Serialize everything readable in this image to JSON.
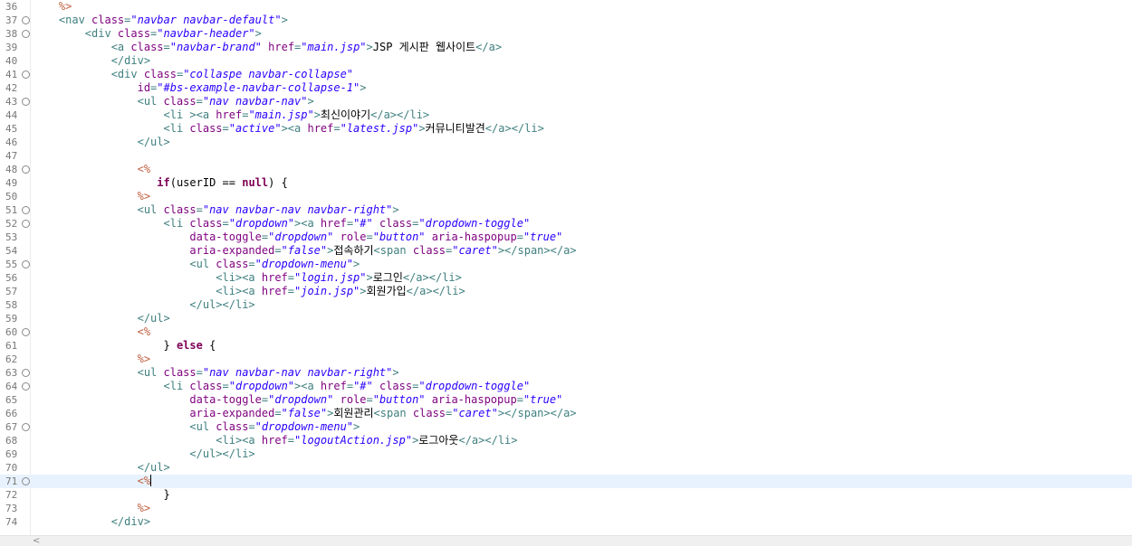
{
  "editor": {
    "current_line": "71",
    "lines": [
      {
        "n": "36",
        "fold": false,
        "indent": "    ",
        "tokens": [
          {
            "t": "%>",
            "c": "jsp"
          }
        ]
      },
      {
        "n": "37",
        "fold": true,
        "indent": "    ",
        "tokens": [
          {
            "t": "<nav ",
            "c": "tag"
          },
          {
            "t": "class",
            "c": "attr"
          },
          {
            "t": "=",
            "c": "tag"
          },
          {
            "t": "\"navbar navbar-default\"",
            "c": "val"
          },
          {
            "t": ">",
            "c": "tag"
          }
        ]
      },
      {
        "n": "38",
        "fold": true,
        "indent": "        ",
        "tokens": [
          {
            "t": "<div ",
            "c": "tag"
          },
          {
            "t": "class",
            "c": "attr"
          },
          {
            "t": "=",
            "c": "tag"
          },
          {
            "t": "\"navbar-header\"",
            "c": "val"
          },
          {
            "t": ">",
            "c": "tag"
          }
        ]
      },
      {
        "n": "39",
        "fold": false,
        "indent": "            ",
        "tokens": [
          {
            "t": "<a ",
            "c": "tag"
          },
          {
            "t": "class",
            "c": "attr"
          },
          {
            "t": "=",
            "c": "tag"
          },
          {
            "t": "\"navbar-brand\"",
            "c": "val"
          },
          {
            "t": " ",
            "c": "tag"
          },
          {
            "t": "href",
            "c": "attr"
          },
          {
            "t": "=",
            "c": "tag"
          },
          {
            "t": "\"main.jsp\"",
            "c": "val"
          },
          {
            "t": ">",
            "c": "tag"
          },
          {
            "t": "JSP 게시판 웹사이트",
            "c": "text"
          },
          {
            "t": "</a>",
            "c": "tag"
          }
        ]
      },
      {
        "n": "40",
        "fold": false,
        "indent": "            ",
        "tokens": [
          {
            "t": "</div>",
            "c": "tag"
          }
        ]
      },
      {
        "n": "41",
        "fold": true,
        "indent": "            ",
        "tokens": [
          {
            "t": "<div ",
            "c": "tag"
          },
          {
            "t": "class",
            "c": "attr"
          },
          {
            "t": "=",
            "c": "tag"
          },
          {
            "t": "\"collaspe navbar-collapse\"",
            "c": "val"
          }
        ]
      },
      {
        "n": "42",
        "fold": false,
        "indent": "                ",
        "tokens": [
          {
            "t": "id",
            "c": "attr"
          },
          {
            "t": "=",
            "c": "tag"
          },
          {
            "t": "\"#bs-example-navbar-collapse-1\"",
            "c": "val"
          },
          {
            "t": ">",
            "c": "tag"
          }
        ]
      },
      {
        "n": "43",
        "fold": true,
        "indent": "                ",
        "tokens": [
          {
            "t": "<ul ",
            "c": "tag"
          },
          {
            "t": "class",
            "c": "attr"
          },
          {
            "t": "=",
            "c": "tag"
          },
          {
            "t": "\"nav navbar-nav\"",
            "c": "val"
          },
          {
            "t": ">",
            "c": "tag"
          }
        ]
      },
      {
        "n": "44",
        "fold": false,
        "indent": "                    ",
        "tokens": [
          {
            "t": "<li ><a ",
            "c": "tag"
          },
          {
            "t": "href",
            "c": "attr"
          },
          {
            "t": "=",
            "c": "tag"
          },
          {
            "t": "\"main.jsp\"",
            "c": "val"
          },
          {
            "t": ">",
            "c": "tag"
          },
          {
            "t": "최신이야기",
            "c": "text"
          },
          {
            "t": "</a></li>",
            "c": "tag"
          }
        ]
      },
      {
        "n": "45",
        "fold": false,
        "indent": "                    ",
        "tokens": [
          {
            "t": "<li ",
            "c": "tag"
          },
          {
            "t": "class",
            "c": "attr"
          },
          {
            "t": "=",
            "c": "tag"
          },
          {
            "t": "\"active\"",
            "c": "val"
          },
          {
            "t": "><a ",
            "c": "tag"
          },
          {
            "t": "href",
            "c": "attr"
          },
          {
            "t": "=",
            "c": "tag"
          },
          {
            "t": "\"latest.jsp\"",
            "c": "val"
          },
          {
            "t": ">",
            "c": "tag"
          },
          {
            "t": "커뮤니티발견",
            "c": "text"
          },
          {
            "t": "</a></li>",
            "c": "tag"
          }
        ]
      },
      {
        "n": "46",
        "fold": false,
        "indent": "                ",
        "tokens": [
          {
            "t": "</ul>",
            "c": "tag"
          }
        ]
      },
      {
        "n": "47",
        "fold": false,
        "indent": "",
        "tokens": []
      },
      {
        "n": "48",
        "fold": true,
        "indent": "                ",
        "tokens": [
          {
            "t": "<%",
            "c": "jsp"
          }
        ]
      },
      {
        "n": "49",
        "fold": false,
        "indent": "                   ",
        "tokens": [
          {
            "t": "if",
            "c": "kw"
          },
          {
            "t": "(userID == ",
            "c": "text"
          },
          {
            "t": "null",
            "c": "kw"
          },
          {
            "t": ") {",
            "c": "text"
          }
        ]
      },
      {
        "n": "50",
        "fold": false,
        "indent": "                ",
        "tokens": [
          {
            "t": "%>",
            "c": "jsp"
          }
        ]
      },
      {
        "n": "51",
        "fold": true,
        "indent": "                ",
        "tokens": [
          {
            "t": "<ul ",
            "c": "tag"
          },
          {
            "t": "class",
            "c": "attr"
          },
          {
            "t": "=",
            "c": "tag"
          },
          {
            "t": "\"nav navbar-nav navbar-right\"",
            "c": "val"
          },
          {
            "t": ">",
            "c": "tag"
          }
        ]
      },
      {
        "n": "52",
        "fold": true,
        "indent": "                    ",
        "tokens": [
          {
            "t": "<li ",
            "c": "tag"
          },
          {
            "t": "class",
            "c": "attr"
          },
          {
            "t": "=",
            "c": "tag"
          },
          {
            "t": "\"dropdown\"",
            "c": "val"
          },
          {
            "t": "><a ",
            "c": "tag"
          },
          {
            "t": "href",
            "c": "attr"
          },
          {
            "t": "=",
            "c": "tag"
          },
          {
            "t": "\"#\"",
            "c": "val"
          },
          {
            "t": " ",
            "c": "tag"
          },
          {
            "t": "class",
            "c": "attr"
          },
          {
            "t": "=",
            "c": "tag"
          },
          {
            "t": "\"dropdown-toggle\"",
            "c": "val"
          }
        ]
      },
      {
        "n": "53",
        "fold": false,
        "indent": "                        ",
        "tokens": [
          {
            "t": "data-toggle",
            "c": "attr"
          },
          {
            "t": "=",
            "c": "tag"
          },
          {
            "t": "\"dropdown\"",
            "c": "val"
          },
          {
            "t": " ",
            "c": "tag"
          },
          {
            "t": "role",
            "c": "attr"
          },
          {
            "t": "=",
            "c": "tag"
          },
          {
            "t": "\"button\"",
            "c": "val"
          },
          {
            "t": " ",
            "c": "tag"
          },
          {
            "t": "aria-haspopup",
            "c": "attr"
          },
          {
            "t": "=",
            "c": "tag"
          },
          {
            "t": "\"true\"",
            "c": "val"
          }
        ]
      },
      {
        "n": "54",
        "fold": false,
        "indent": "                        ",
        "tokens": [
          {
            "t": "aria-expanded",
            "c": "attr"
          },
          {
            "t": "=",
            "c": "tag"
          },
          {
            "t": "\"false\"",
            "c": "val"
          },
          {
            "t": ">",
            "c": "tag"
          },
          {
            "t": "접속하기",
            "c": "text"
          },
          {
            "t": "<span ",
            "c": "tag"
          },
          {
            "t": "class",
            "c": "attr"
          },
          {
            "t": "=",
            "c": "tag"
          },
          {
            "t": "\"caret\"",
            "c": "val"
          },
          {
            "t": "></span></a>",
            "c": "tag"
          }
        ]
      },
      {
        "n": "55",
        "fold": true,
        "indent": "                        ",
        "tokens": [
          {
            "t": "<ul ",
            "c": "tag"
          },
          {
            "t": "class",
            "c": "attr"
          },
          {
            "t": "=",
            "c": "tag"
          },
          {
            "t": "\"dropdown-menu\"",
            "c": "val"
          },
          {
            "t": ">",
            "c": "tag"
          }
        ]
      },
      {
        "n": "56",
        "fold": false,
        "indent": "                            ",
        "tokens": [
          {
            "t": "<li><a ",
            "c": "tag"
          },
          {
            "t": "href",
            "c": "attr"
          },
          {
            "t": "=",
            "c": "tag"
          },
          {
            "t": "\"login.jsp\"",
            "c": "val"
          },
          {
            "t": ">",
            "c": "tag"
          },
          {
            "t": "로그인",
            "c": "text"
          },
          {
            "t": "</a></li>",
            "c": "tag"
          }
        ]
      },
      {
        "n": "57",
        "fold": false,
        "indent": "                            ",
        "tokens": [
          {
            "t": "<li><a ",
            "c": "tag"
          },
          {
            "t": "href",
            "c": "attr"
          },
          {
            "t": "=",
            "c": "tag"
          },
          {
            "t": "\"join.jsp\"",
            "c": "val"
          },
          {
            "t": ">",
            "c": "tag"
          },
          {
            "t": "회원가입",
            "c": "text"
          },
          {
            "t": "</a></li>",
            "c": "tag"
          }
        ]
      },
      {
        "n": "58",
        "fold": false,
        "indent": "                        ",
        "tokens": [
          {
            "t": "</ul></li>",
            "c": "tag"
          }
        ]
      },
      {
        "n": "59",
        "fold": false,
        "indent": "                ",
        "tokens": [
          {
            "t": "</ul>",
            "c": "tag"
          }
        ]
      },
      {
        "n": "60",
        "fold": true,
        "indent": "                ",
        "tokens": [
          {
            "t": "<%",
            "c": "jsp"
          }
        ]
      },
      {
        "n": "61",
        "fold": false,
        "indent": "                    ",
        "tokens": [
          {
            "t": "} ",
            "c": "text"
          },
          {
            "t": "else",
            "c": "kw"
          },
          {
            "t": " {",
            "c": "text"
          }
        ]
      },
      {
        "n": "62",
        "fold": false,
        "indent": "                ",
        "tokens": [
          {
            "t": "%>",
            "c": "jsp"
          }
        ]
      },
      {
        "n": "63",
        "fold": true,
        "indent": "                ",
        "tokens": [
          {
            "t": "<ul ",
            "c": "tag"
          },
          {
            "t": "class",
            "c": "attr"
          },
          {
            "t": "=",
            "c": "tag"
          },
          {
            "t": "\"nav navbar-nav navbar-right\"",
            "c": "val"
          },
          {
            "t": ">",
            "c": "tag"
          }
        ]
      },
      {
        "n": "64",
        "fold": true,
        "indent": "                    ",
        "tokens": [
          {
            "t": "<li ",
            "c": "tag"
          },
          {
            "t": "class",
            "c": "attr"
          },
          {
            "t": "=",
            "c": "tag"
          },
          {
            "t": "\"dropdown\"",
            "c": "val"
          },
          {
            "t": "><a ",
            "c": "tag"
          },
          {
            "t": "href",
            "c": "attr"
          },
          {
            "t": "=",
            "c": "tag"
          },
          {
            "t": "\"#\"",
            "c": "val"
          },
          {
            "t": " ",
            "c": "tag"
          },
          {
            "t": "class",
            "c": "attr"
          },
          {
            "t": "=",
            "c": "tag"
          },
          {
            "t": "\"dropdown-toggle\"",
            "c": "val"
          }
        ]
      },
      {
        "n": "65",
        "fold": false,
        "indent": "                        ",
        "tokens": [
          {
            "t": "data-toggle",
            "c": "attr"
          },
          {
            "t": "=",
            "c": "tag"
          },
          {
            "t": "\"dropdown\"",
            "c": "val"
          },
          {
            "t": " ",
            "c": "tag"
          },
          {
            "t": "role",
            "c": "attr"
          },
          {
            "t": "=",
            "c": "tag"
          },
          {
            "t": "\"button\"",
            "c": "val"
          },
          {
            "t": " ",
            "c": "tag"
          },
          {
            "t": "aria-haspopup",
            "c": "attr"
          },
          {
            "t": "=",
            "c": "tag"
          },
          {
            "t": "\"true\"",
            "c": "val"
          }
        ]
      },
      {
        "n": "66",
        "fold": false,
        "indent": "                        ",
        "tokens": [
          {
            "t": "aria-expanded",
            "c": "attr"
          },
          {
            "t": "=",
            "c": "tag"
          },
          {
            "t": "\"false\"",
            "c": "val"
          },
          {
            "t": ">",
            "c": "tag"
          },
          {
            "t": "회원관리",
            "c": "text"
          },
          {
            "t": "<span ",
            "c": "tag"
          },
          {
            "t": "class",
            "c": "attr"
          },
          {
            "t": "=",
            "c": "tag"
          },
          {
            "t": "\"caret\"",
            "c": "val"
          },
          {
            "t": "></span></a>",
            "c": "tag"
          }
        ]
      },
      {
        "n": "67",
        "fold": true,
        "indent": "                        ",
        "tokens": [
          {
            "t": "<ul ",
            "c": "tag"
          },
          {
            "t": "class",
            "c": "attr"
          },
          {
            "t": "=",
            "c": "tag"
          },
          {
            "t": "\"dropdown-menu\"",
            "c": "val"
          },
          {
            "t": ">",
            "c": "tag"
          }
        ]
      },
      {
        "n": "68",
        "fold": false,
        "indent": "                            ",
        "tokens": [
          {
            "t": "<li><a ",
            "c": "tag"
          },
          {
            "t": "href",
            "c": "attr"
          },
          {
            "t": "=",
            "c": "tag"
          },
          {
            "t": "\"logoutAction.jsp\"",
            "c": "val"
          },
          {
            "t": ">",
            "c": "tag"
          },
          {
            "t": "로그아웃",
            "c": "text"
          },
          {
            "t": "</a></li>",
            "c": "tag"
          }
        ]
      },
      {
        "n": "69",
        "fold": false,
        "indent": "                        ",
        "tokens": [
          {
            "t": "</ul></li>",
            "c": "tag"
          }
        ]
      },
      {
        "n": "70",
        "fold": false,
        "indent": "                ",
        "tokens": [
          {
            "t": "</ul>",
            "c": "tag"
          }
        ]
      },
      {
        "n": "71",
        "fold": true,
        "indent": "                ",
        "tokens": [
          {
            "t": "<%",
            "c": "jsp"
          }
        ],
        "caret": true
      },
      {
        "n": "72",
        "fold": false,
        "indent": "                    ",
        "tokens": [
          {
            "t": "}",
            "c": "text"
          }
        ]
      },
      {
        "n": "73",
        "fold": false,
        "indent": "                ",
        "tokens": [
          {
            "t": "%>",
            "c": "jsp"
          }
        ]
      },
      {
        "n": "74",
        "fold": false,
        "indent": "            ",
        "tokens": [
          {
            "t": "</div>",
            "c": "tag"
          }
        ]
      }
    ]
  },
  "icons": {
    "fold_icon": "⊖",
    "scroll_left_icon": "<"
  },
  "colors": {
    "tag": "#3f7f7f",
    "attribute": "#7f007f",
    "attribute_value": "#2a00ff",
    "jsp_delimiter": "#bf5f3f",
    "keyword": "#7f0055",
    "current_line": "#e8f2fe"
  }
}
